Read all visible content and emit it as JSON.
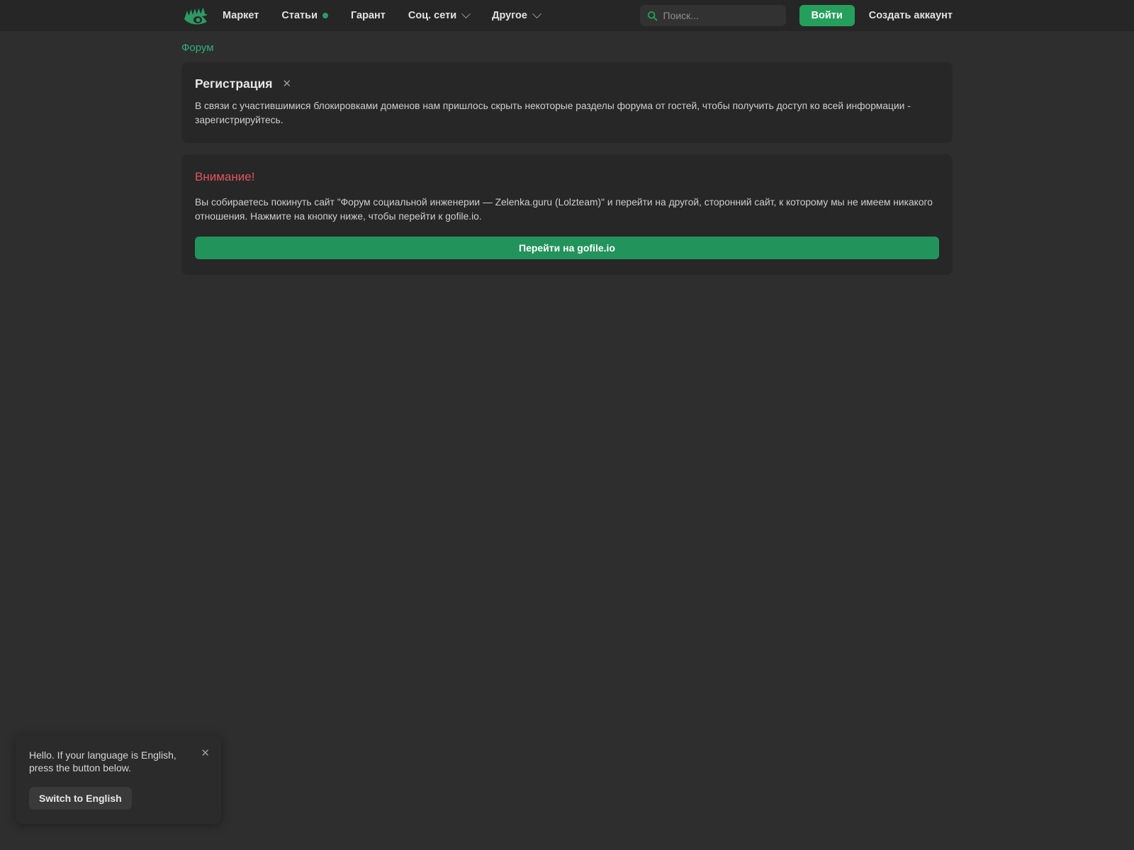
{
  "header": {
    "logo_icon": "eye-brow-logo-icon",
    "nav_items": [
      {
        "label": "Маркет",
        "has_dot": false,
        "has_chevron": false
      },
      {
        "label": "Статьи",
        "has_dot": true,
        "has_chevron": false
      },
      {
        "label": "Гарант",
        "has_dot": false,
        "has_chevron": false
      },
      {
        "label": "Соц. сети",
        "has_dot": false,
        "has_chevron": true
      },
      {
        "label": "Другое",
        "has_dot": false,
        "has_chevron": true
      }
    ],
    "search": {
      "placeholder": "Поиск...",
      "value": "",
      "icon": "search-icon"
    },
    "login_label": "Войти",
    "register_label": "Создать аккаунт"
  },
  "breadcrumb": {
    "label": "Форум"
  },
  "registration_panel": {
    "title": "Регистрация",
    "close_label": "✕",
    "body": "В связи с участившимися блокировками доменов нам пришлось скрыть некоторые разделы форума от гостей, чтобы получить доступ ко всей информации - зарегистрируйтесь."
  },
  "warning_panel": {
    "title": "Внимание!",
    "body": "Вы собираетесь покинуть сайт \"Форум социальной инженерии — Zelenka.guru (Lolzteam)\" и перейти на другой, сторонний сайт, к которому мы не имеем никакого отношения. Нажмите на кнопку ниже, чтобы перейти к gofile.io.",
    "button_label": "Перейти на gofile.io"
  },
  "language_popup": {
    "message": "Hello. If your language is English, press the button below.",
    "close_label": "✕",
    "button_label": "Switch to English"
  },
  "colors": {
    "page_bg": "#2e2e2e",
    "header_bg": "#262626",
    "panel_bg": "#272727",
    "accent_green": "#24a05c",
    "link_green": "#2eb277",
    "warning_red": "#e0545f",
    "popup_bg": "#2b2b2b"
  }
}
